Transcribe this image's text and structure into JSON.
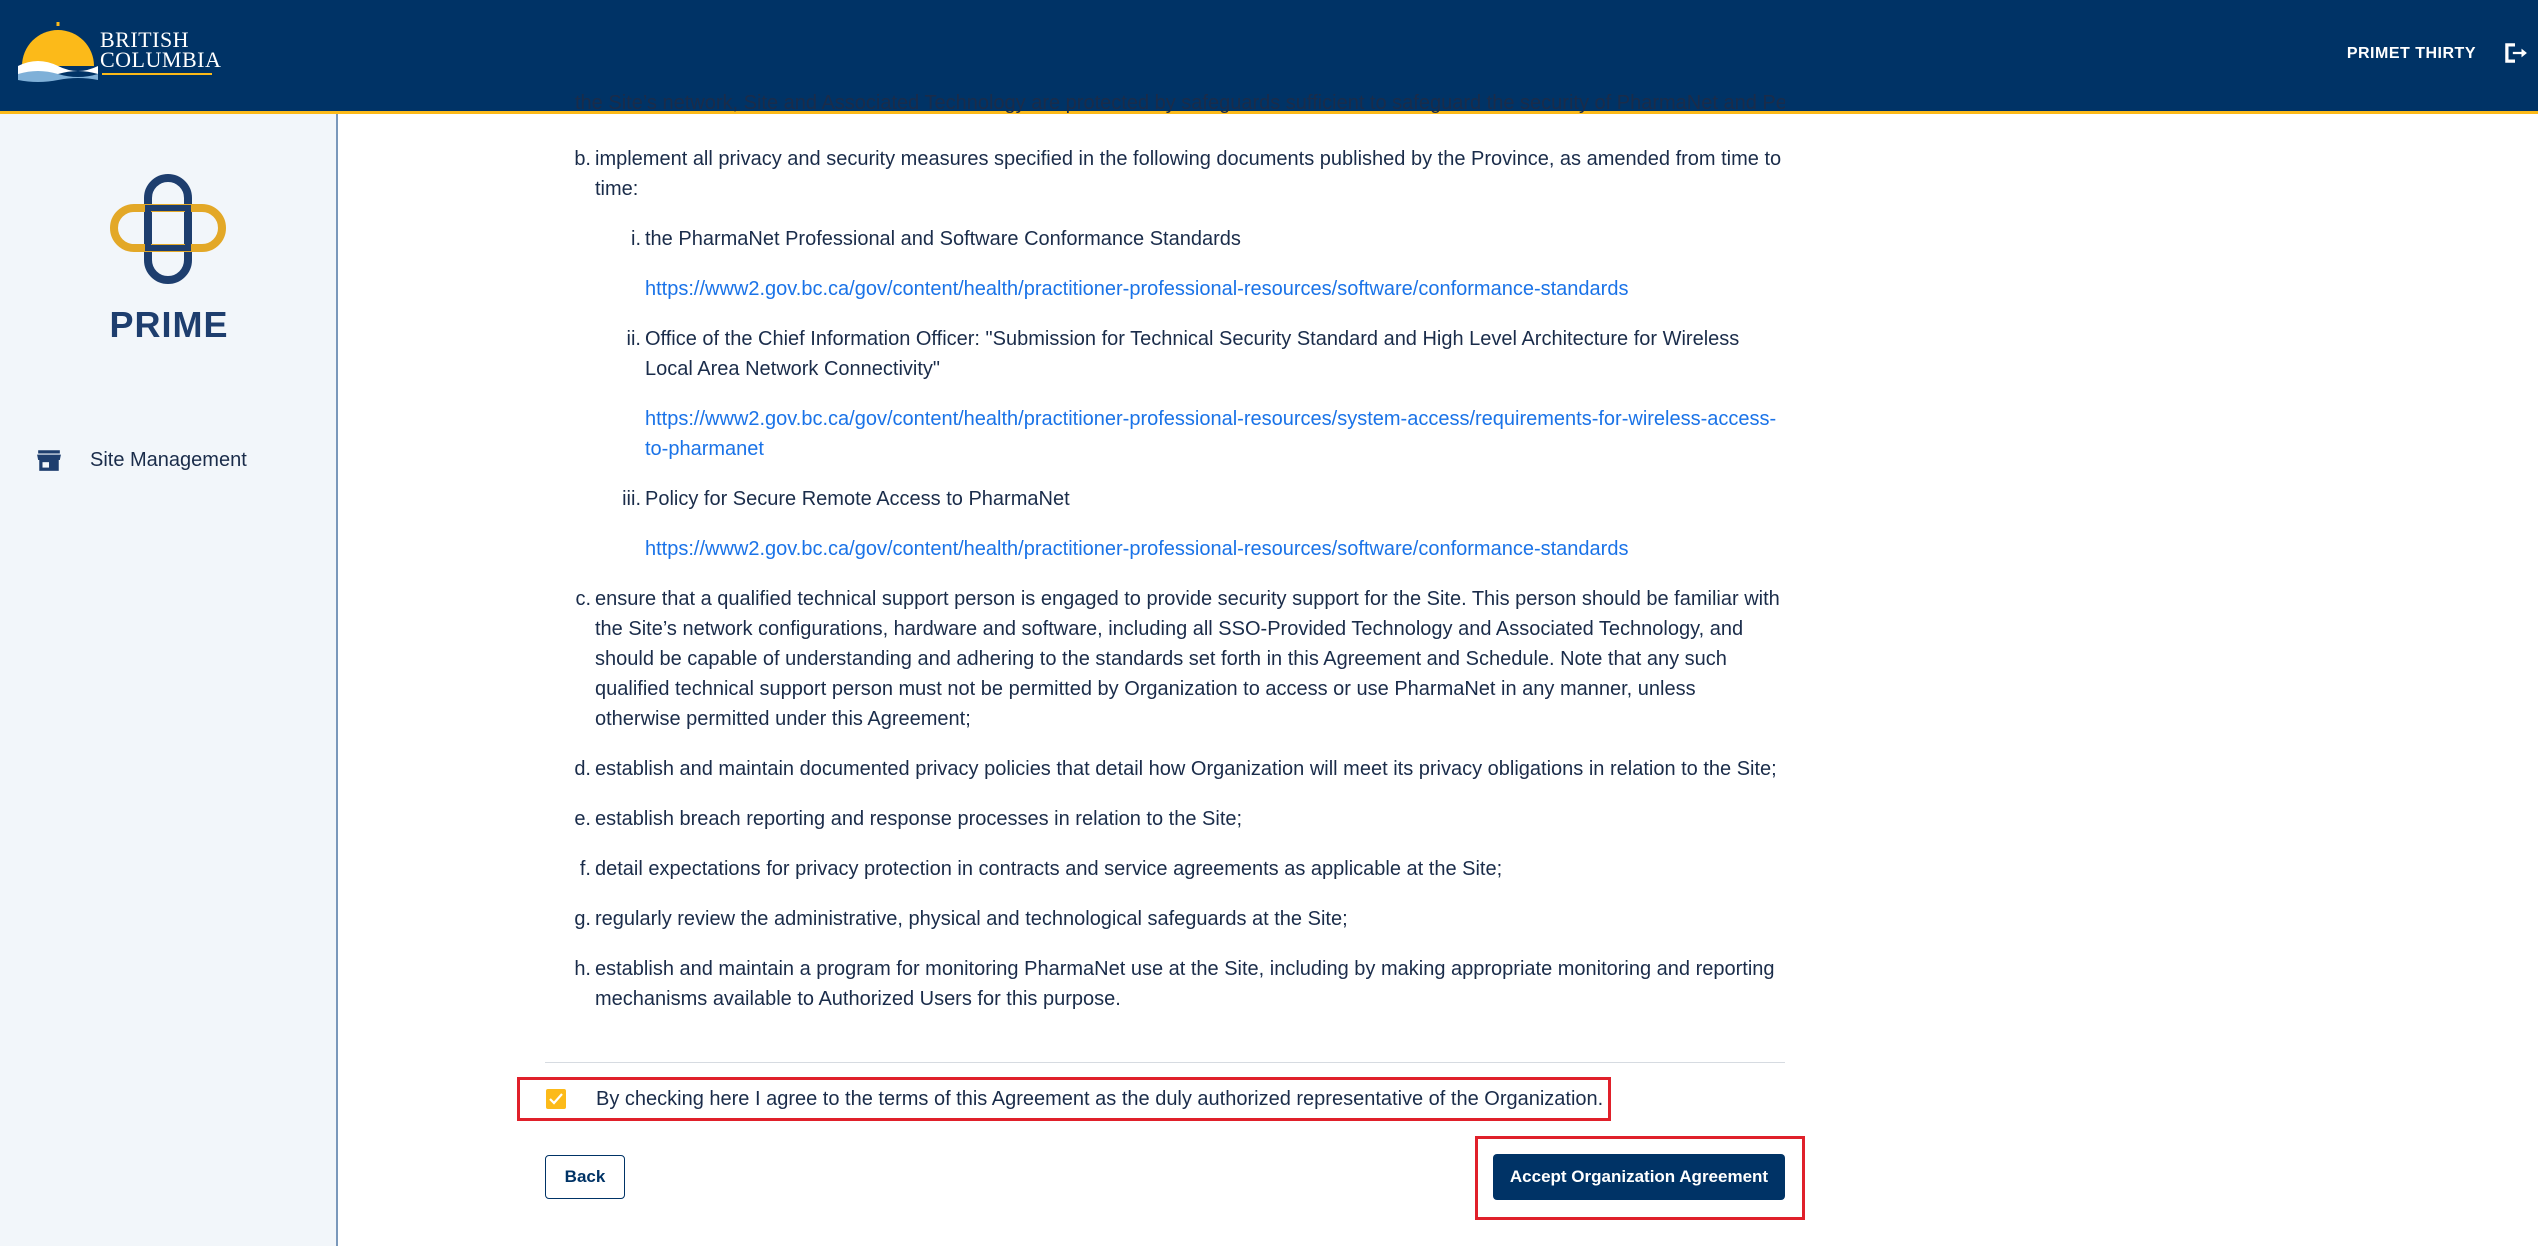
{
  "header": {
    "logo_line1": "BRITISH",
    "logo_line2": "COLUMBIA",
    "user_name": "PRIMET THIRTY",
    "logout_icon": "logout-icon"
  },
  "sidebar": {
    "app_title": "PRIME",
    "items": [
      {
        "label": "Site Management",
        "icon": "store-icon"
      }
    ]
  },
  "agreement": {
    "partial_line": "the Site’s network, Site and Associated Technology are protected by safeguards sufficient to safeguard the security of PharmaNet and Personal Information;",
    "items": [
      {
        "marker": "b.",
        "text": "implement all privacy and security measures specified in the following documents published by the Province, as amended from time to time:",
        "subitems": [
          {
            "marker": "i.",
            "text": "the PharmaNet Professional and Software Conformance Standards",
            "link": "https://www2.gov.bc.ca/gov/content/health/practitioner-professional-resources/software/conformance-standards"
          },
          {
            "marker": "ii.",
            "text": "Office of the Chief Information Officer: \"Submission for Technical Security Standard and High Level Architecture for Wireless Local Area Network Connectivity\"",
            "link": "https://www2.gov.bc.ca/gov/content/health/practitioner-professional-resources/system-access/requirements-for-wireless-access-to-pharmanet"
          },
          {
            "marker": "iii.",
            "text": "Policy for Secure Remote Access to PharmaNet",
            "link": "https://www2.gov.bc.ca/gov/content/health/practitioner-professional-resources/software/conformance-standards"
          }
        ]
      },
      {
        "marker": "c.",
        "text": "ensure that a qualified technical support person is engaged to provide security support for the Site. This person should be familiar with the Site’s network configurations, hardware and software, including all SSO-Provided Technology and Associated Technology, and should be capable of understanding and adhering to the standards set forth in this Agreement and Schedule. Note that any such qualified technical support person must not be permitted by Organization to access or use PharmaNet in any manner, unless otherwise permitted under this Agreement;"
      },
      {
        "marker": "d.",
        "text": "establish and maintain documented privacy policies that detail how Organization will meet its privacy obligations in relation to the Site;"
      },
      {
        "marker": "e.",
        "text": "establish breach reporting and response processes in relation to the Site;"
      },
      {
        "marker": "f.",
        "text": "detail expectations for privacy protection in contracts and service agreements as applicable at the Site;"
      },
      {
        "marker": "g.",
        "text": "regularly review the administrative, physical and technological safeguards at the Site;"
      },
      {
        "marker": "h.",
        "text": "establish and maintain a program for monitoring PharmaNet use at the Site, including by making appropriate monitoring and reporting mechanisms available to Authorized Users for this purpose."
      }
    ],
    "agree_text": "By checking here I agree to the terms of this Agreement as the duly authorized representative of the Organization.",
    "agree_checked": true,
    "back_label": "Back",
    "accept_label": "Accept Organization Agreement"
  },
  "colors": {
    "header_bg": "#003366",
    "accent_gold": "#fcba19",
    "link": "#1a73e8",
    "highlight_red": "#e0202a"
  }
}
